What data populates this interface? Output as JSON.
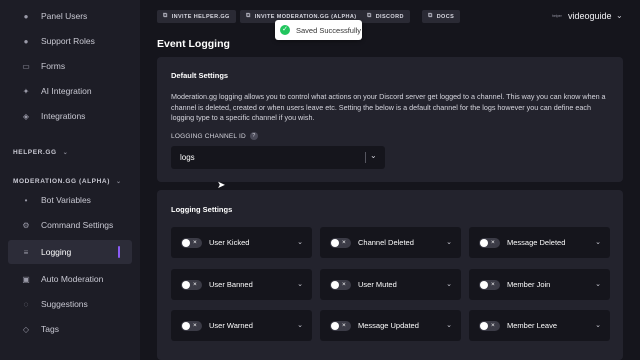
{
  "sidebar": {
    "items_top": [
      {
        "label": "Panel Users",
        "icon": "users-icon"
      },
      {
        "label": "Support Roles",
        "icon": "shield-icon"
      },
      {
        "label": "Forms",
        "icon": "form-icon"
      },
      {
        "label": "AI Integration",
        "icon": "ai-icon"
      },
      {
        "label": "Integrations",
        "icon": "plug-icon"
      }
    ],
    "section_helper": "HELPER.GG",
    "section_moderation": "MODERATION.GG (ALPHA)",
    "items_moderation": [
      {
        "label": "Bot Variables",
        "icon": "variable-icon"
      },
      {
        "label": "Command Settings",
        "icon": "gear-icon"
      },
      {
        "label": "Logging",
        "icon": "list-icon"
      },
      {
        "label": "Auto Moderation",
        "icon": "robot-icon"
      },
      {
        "label": "Suggestions",
        "icon": "bulb-icon"
      },
      {
        "label": "Tags",
        "icon": "tag-icon"
      }
    ]
  },
  "topbar": {
    "links": [
      "INVITE HELPER.GG",
      "INVITE MODERATION.GG (ALPHA)",
      "DISCORD",
      "DOCS"
    ],
    "brand_prefix": "helper",
    "brand": "videoguide"
  },
  "toast": {
    "message": "Saved Successfully"
  },
  "page": {
    "title": "Event Logging"
  },
  "default_settings": {
    "title": "Default Settings",
    "description": "Moderation.gg logging allows you to control what actions on your Discord server get logged to a channel. This way you can know when a channel is deleted, created or when users leave etc. Setting the below is a default channel for the logs however you can define each logging type to a specific channel if you wish.",
    "channel_label": "LOGGING CHANNEL ID",
    "channel_value": "logs"
  },
  "logging_settings": {
    "title": "Logging Settings",
    "events": [
      "User Kicked",
      "Channel Deleted",
      "Message Deleted",
      "User Banned",
      "User Muted",
      "Member Join",
      "User Warned",
      "Message Updated",
      "Member Leave"
    ]
  },
  "colors": {
    "accent": "#8b5cf6",
    "success": "#22c55e",
    "bg": "#15151c",
    "card": "#23232d"
  }
}
